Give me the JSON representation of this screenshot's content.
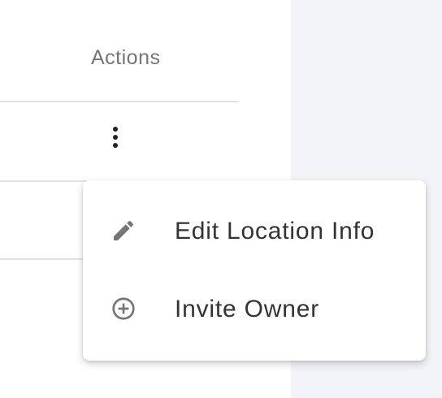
{
  "table": {
    "actions_header": "Actions"
  },
  "rows": [
    {
      "actions_icon": "more-vert-icon"
    },
    {
      "actions_icon": "none"
    }
  ],
  "menu": {
    "items": [
      {
        "label": "Edit Location Info",
        "icon": "pencil-icon"
      },
      {
        "label": "Invite Owner",
        "icon": "add-circle-outline-icon"
      }
    ]
  },
  "colors": {
    "side_panel": "#f3f4f8",
    "divider": "#e2e2e2",
    "header_text": "#757575",
    "menu_text": "#333333",
    "icon": "#757575"
  }
}
